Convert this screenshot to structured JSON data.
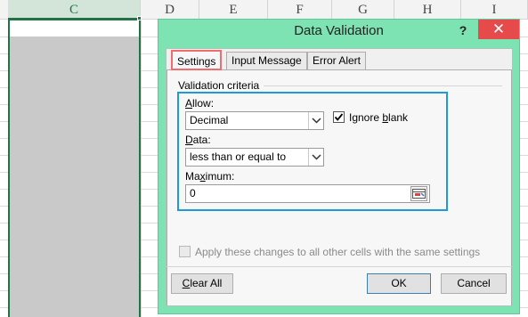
{
  "sheet": {
    "columns": [
      "C",
      "D",
      "E",
      "F",
      "G",
      "H",
      "I"
    ],
    "selected_column": "C"
  },
  "dialog": {
    "title": "Data Validation",
    "help": "?",
    "close": "✕",
    "tabs": [
      "Settings",
      "Input Message",
      "Error Alert"
    ],
    "active_tab": "Settings",
    "group_label": "Validation criteria",
    "allow_label": "Allow:",
    "allow_value": "Decimal",
    "ignore_blank_label": "Ignore blank",
    "ignore_blank_checked": true,
    "data_label": "Data:",
    "data_value": "less than or equal to",
    "maximum_label": "Maximum:",
    "maximum_value": "0",
    "apply_all_label": "Apply these changes to all other cells with the same settings",
    "apply_all_checked": false,
    "clear_all": "Clear All",
    "ok": "OK",
    "cancel": "Cancel"
  },
  "colors": {
    "dialog_frame": "#7de3b2",
    "close_button": "#e64a4a",
    "highlight_box": "#1e9ad6",
    "active_tab_border": "#ef6d6d",
    "selection": "#217346"
  },
  "icons": {
    "dropdown": "chevron-down-icon",
    "range": "range-select-icon",
    "check": "checkmark-icon"
  }
}
